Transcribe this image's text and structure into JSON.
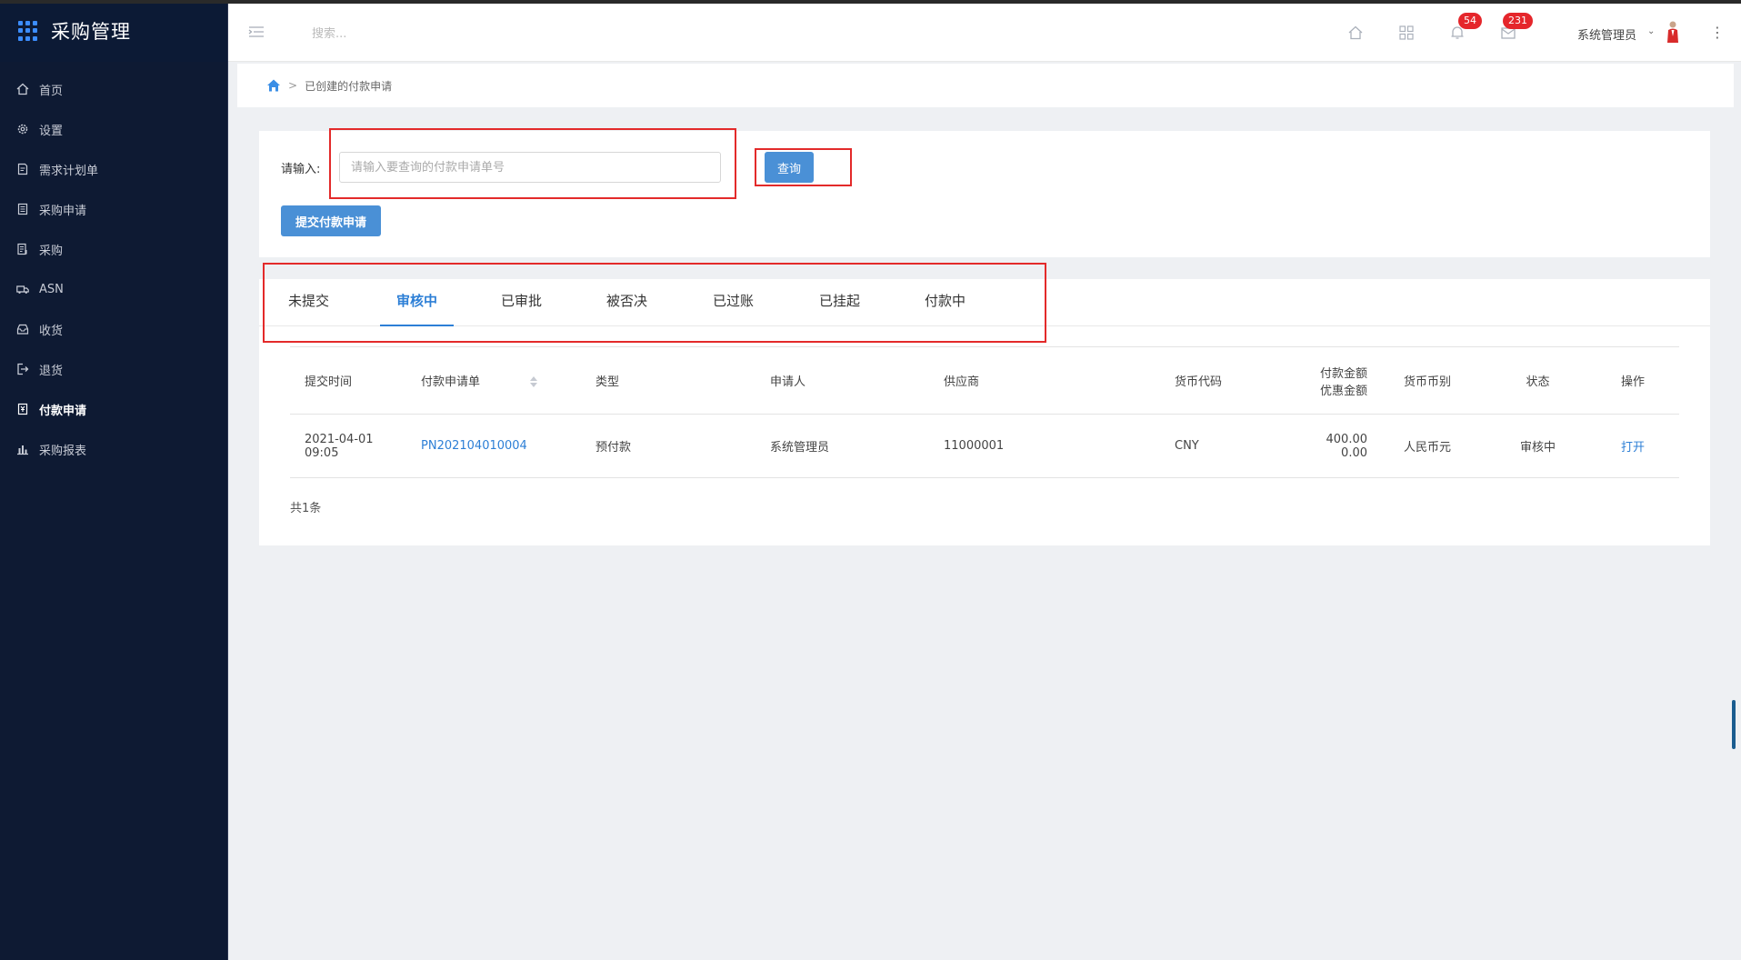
{
  "app": {
    "title": "采购管理"
  },
  "sidebar": {
    "items": [
      {
        "label": "首页",
        "icon": "home-icon"
      },
      {
        "label": "设置",
        "icon": "gear-icon"
      },
      {
        "label": "需求计划单",
        "icon": "document-icon"
      },
      {
        "label": "采购申请",
        "icon": "clipboard-icon"
      },
      {
        "label": "采购",
        "icon": "list-icon"
      },
      {
        "label": "ASN",
        "icon": "truck-icon"
      },
      {
        "label": "收货",
        "icon": "inbox-icon"
      },
      {
        "label": "退货",
        "icon": "return-icon"
      },
      {
        "label": "付款申请",
        "icon": "payment-icon",
        "active": true
      },
      {
        "label": "采购报表",
        "icon": "bar-chart-icon"
      }
    ]
  },
  "header": {
    "search_placeholder": "搜索...",
    "notifications_count": "54",
    "messages_count": "231",
    "user_name": "系统管理员"
  },
  "breadcrumb": {
    "current": "已创建的付款申请",
    "separator": ">"
  },
  "search": {
    "label": "请输入:",
    "placeholder": "请输入要查询的付款申请单号",
    "value": "",
    "query_button": "查询",
    "submit_button": "提交付款申请"
  },
  "tabs": [
    {
      "label": "未提交"
    },
    {
      "label": "审核中",
      "active": true
    },
    {
      "label": "已审批"
    },
    {
      "label": "被否决"
    },
    {
      "label": "已过账"
    },
    {
      "label": "已挂起"
    },
    {
      "label": "付款中"
    }
  ],
  "table": {
    "headers": {
      "time": "提交时间",
      "number": "付款申请单",
      "type": "类型",
      "applicant": "申请人",
      "supplier": "供应商",
      "currency_code": "货币代码",
      "amount": "付款金额",
      "discount": "优惠金额",
      "currency": "货币币别",
      "status": "状态",
      "action": "操作"
    },
    "rows": [
      {
        "date": "2021-04-01",
        "time": "09:05",
        "number": "PN202104010004",
        "type": "预付款",
        "applicant": "系统管理员",
        "supplier": "11000001",
        "currency_code": "CNY",
        "amount": "400.00",
        "discount": "0.00",
        "currency": "人民币元",
        "status": "审核中",
        "action": "打开"
      }
    ],
    "total": "共1条"
  },
  "colors": {
    "accent": "#4a90d6",
    "link": "#2d7fd6",
    "sidebar_bg": "#0e1a33",
    "badge": "#e5262b",
    "highlight": "#e32a2a"
  }
}
